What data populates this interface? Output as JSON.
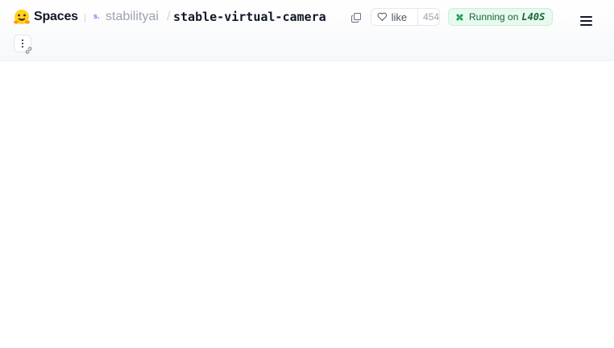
{
  "header": {
    "brand": "Spaces",
    "owner_avatar_text": "s.",
    "owner": "stabilityai",
    "separator": "/",
    "repo": "stable-virtual-camera",
    "like_label": "like",
    "like_count": "454",
    "status_prefix": "Running on",
    "status_hardware": "L40S"
  },
  "icons": {
    "logo": "hugging-face-emoji-icon",
    "copy": "copy-icon",
    "like": "heart-icon",
    "status": "fan-icon",
    "menu": "hamburger-menu-icon",
    "more": "more-vertical-icon",
    "link": "link-icon"
  },
  "colors": {
    "status_bg": "#e8faf0",
    "status_text": "#166534",
    "owner_text": "#9ca3af",
    "accent_purple": "#9b5de5"
  }
}
